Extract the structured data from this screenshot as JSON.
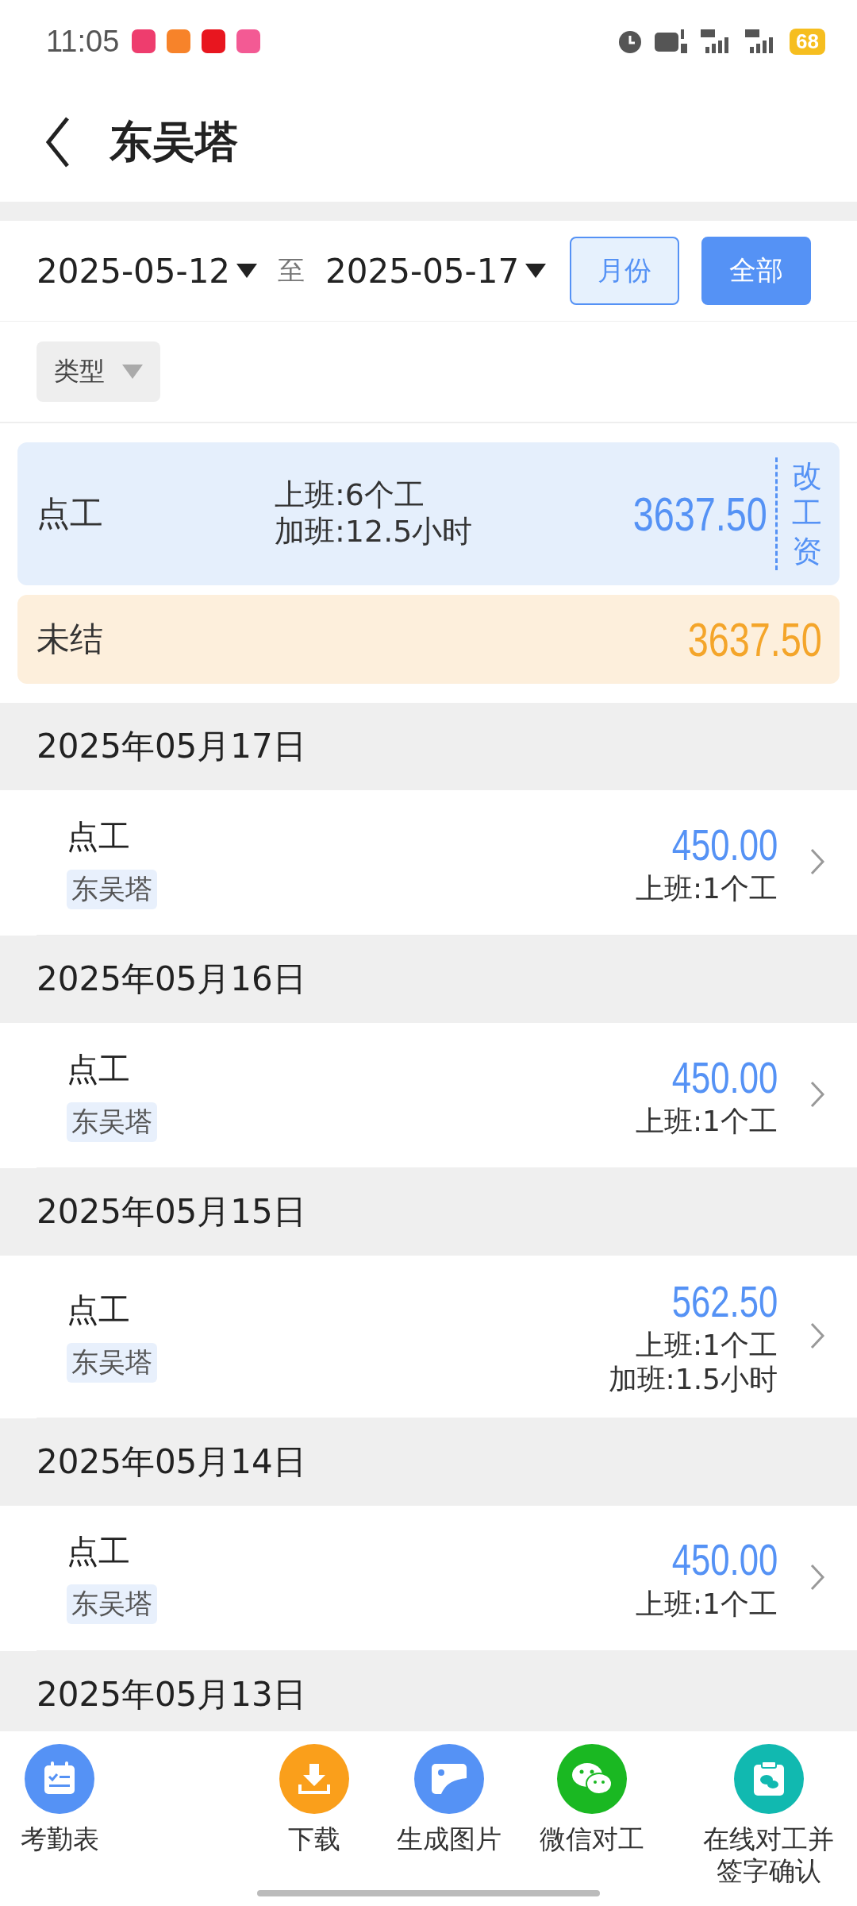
{
  "status_bar": {
    "time": "11:05",
    "battery": "68"
  },
  "header": {
    "title": "东吴塔"
  },
  "filter": {
    "start_date": "2025-05-12",
    "separator": "至",
    "end_date": "2025-05-17",
    "buttons": [
      {
        "label": "月份",
        "selected": false
      },
      {
        "label": "全部",
        "selected": true
      }
    ]
  },
  "type_filter": {
    "label": "类型"
  },
  "summary": {
    "label": "点工",
    "lines": [
      "上班:6个工",
      "加班:12.5小时"
    ],
    "amount": "3637.50",
    "edit": "改工资"
  },
  "unsettled": {
    "label": "未结",
    "amount": "3637.50"
  },
  "days": [
    {
      "date": "2025年05月17日",
      "entries": [
        {
          "title": "点工",
          "tag": "东吴塔",
          "amount": "450.00",
          "details": [
            "上班:1个工"
          ]
        }
      ]
    },
    {
      "date": "2025年05月16日",
      "entries": [
        {
          "title": "点工",
          "tag": "东吴塔",
          "amount": "450.00",
          "details": [
            "上班:1个工"
          ]
        }
      ]
    },
    {
      "date": "2025年05月15日",
      "entries": [
        {
          "title": "点工",
          "tag": "东吴塔",
          "amount": "562.50",
          "details": [
            "上班:1个工",
            "加班:1.5小时"
          ]
        }
      ]
    },
    {
      "date": "2025年05月14日",
      "entries": [
        {
          "title": "点工",
          "tag": "东吴塔",
          "amount": "450.00",
          "details": [
            "上班:1个工"
          ]
        }
      ]
    },
    {
      "date": "2025年05月13日"
    }
  ],
  "bottom_actions": [
    {
      "kind": "calendar",
      "label": "考勤表",
      "color": "#5592f5"
    },
    {
      "kind": "download",
      "label": "下载",
      "color": "#fa9f1b"
    },
    {
      "kind": "image",
      "label": "生成图片",
      "color": "#5592f5"
    },
    {
      "kind": "wechat",
      "label": "微信对工",
      "color": "#1ab822"
    },
    {
      "kind": "clipboard",
      "label": "在线对工并签字确认",
      "color": "#11b9b0"
    }
  ]
}
